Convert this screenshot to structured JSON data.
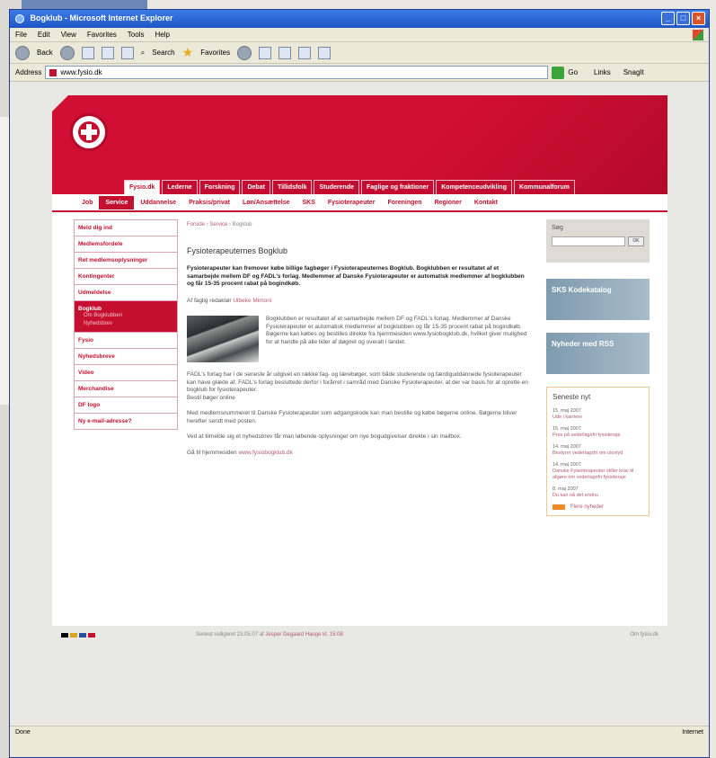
{
  "window": {
    "title": "Bogklub - Microsoft Internet Explorer",
    "menu": [
      "File",
      "Edit",
      "View",
      "Favorites",
      "Tools",
      "Help"
    ],
    "toolbar": {
      "back": "Back",
      "search": "Search",
      "favorites": "Favorites"
    },
    "address_label": "Address",
    "address_url": "www.fysio.dk",
    "go_label": "Go",
    "links_label": "Links",
    "snagit_label": "SnagIt",
    "status_left": "Done",
    "status_right": "Internet"
  },
  "site": {
    "top_tabs": [
      "Fysio.dk",
      "Lederne",
      "Forskning",
      "Debat",
      "Tillidsfolk",
      "Studerende",
      "Faglige og fraktioner",
      "Kompetenceudvikling",
      "Kommunalforum"
    ],
    "sub_nav": [
      "Job",
      "Service",
      "Uddannelse",
      "Praksis/privat",
      "Løn/Ansættelse",
      "SKS",
      "Fysioterapeuter",
      "Foreningen",
      "Regioner",
      "Kontakt"
    ],
    "left_nav": [
      {
        "label": "Meld dig ind"
      },
      {
        "label": "Medlemsfordele"
      },
      {
        "label": "Ret medlemsoplysninger"
      },
      {
        "label": "Kontingenter"
      },
      {
        "label": "Udmeldelse"
      },
      {
        "label": "Bogklub",
        "sub": [
          "Om Bogklubben",
          "Nyhedsbrev"
        ]
      },
      {
        "label": "Fysio"
      },
      {
        "label": "Nyhedsbreve"
      },
      {
        "label": "Video"
      },
      {
        "label": "Merchandise"
      },
      {
        "label": "DF logo"
      },
      {
        "label": "Ny e-mail-adresse?"
      }
    ],
    "breadcrumb": {
      "home": "Forside",
      "section": "Service",
      "current": "Bogklub"
    },
    "heading": "Fysioterapeuternes Bogklub",
    "intro": "Fysioterapeuter kan fremover købe billige fagbøger i Fysioterapeuternes Bogklub. Bogklubben er resultatet af et samarbejde mellem DF og FADL's forlag. Medlemmer af Danske Fysioterapeuter er automatisk medlemmer af bogklubben og får 15-35 procent rabat på bogindkøb.",
    "byline_prefix": "Af faglig redaktør",
    "byline_author": "Ulbeke Mimoni",
    "figure_text": "Bogklubben er resultatet af et samarbejde mellem DF og FADL's forlag. Medlemmer af Danske Fysioterapeuter er automatisk medlemmer af bogklubben og får 15-35 procent rabat på bogindkøb. Bøgerne kan købes og bestilles direkte fra hjemmesiden www.fysiobogklub.dk, hvilket giver mulighed for at handle på alle tider af døgnet og overalt i landet.",
    "para1": "FADL's forlag har i de seneste år udgivet en række fag- og lærebøger, som både studerende og færdiguddannede fysioterapeuter kan have glæde af. FADL's forlag besluttede derfor i forårret i samråd med Danske Fysioterapeuter, at der var basis for at oprette en bogklub for fysioterapeuter.",
    "para1b": "Bestil bøger online",
    "para2": "Med medlemsnummeret til Danske Fysioterapeuter som adgangskode kan man bestille og købe bøgerne online. Bøgerne bliver herefter sendt med posten.",
    "para3": "Ved at tilmelde sig et nyhedsbrev får man løbende oplysninger om nye bogudgivelser direkte i sin mailbox.",
    "para4_prefix": "Gå til hjemmesiden",
    "para4_link": "www.fysiobogklub.dk",
    "search": {
      "label": "Søg",
      "button": "OK"
    },
    "banner1": "SKS Kodekatalog",
    "banner2": "Nyheder med RSS",
    "news": {
      "title": "Seneste nyt",
      "items": [
        {
          "date": "15. maj 2007",
          "text": "Ude i karriere"
        },
        {
          "date": "15. maj 2007",
          "text": "Pres på vederlagsfri fysioterapi"
        },
        {
          "date": "14. maj 2007",
          "text": "Bestyrer vederlagsfri om ulovlyd"
        },
        {
          "date": "14. maj 2007",
          "text": "Danske Fysioterapeuter stiller krav til afgøre om vederlagsfri fysioterapi"
        },
        {
          "date": "8. maj 2007",
          "text": "Du kan nå det endnu"
        }
      ],
      "all_link": "Flere nyheder"
    },
    "footer": {
      "updated": "Senest redigeret 23.05.07 af",
      "updated_by": "Jesper Degaard Hauge kl. 15:08",
      "right": "Om fysio.dk"
    }
  },
  "colors": {
    "brand_red": "#c4102e",
    "link": "#b55a6e",
    "banner_blue": "#8fa9bb"
  }
}
